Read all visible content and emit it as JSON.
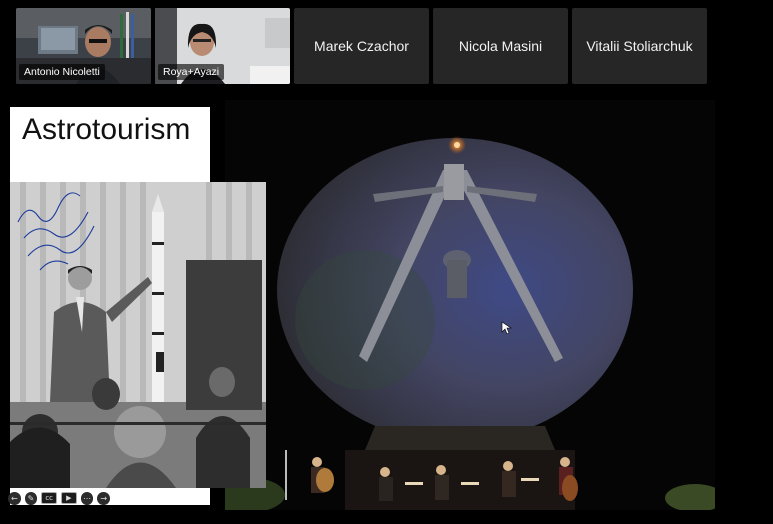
{
  "participants": [
    {
      "name": "Antonio Nicoletti",
      "has_video": true
    },
    {
      "name": "Roya+Ayazi",
      "has_video": true
    },
    {
      "name": "Marek Czachor",
      "has_video": false
    },
    {
      "name": "Nicola Masini",
      "has_video": false
    },
    {
      "name": "Vitalii Stoliarchuk",
      "has_video": false
    }
  ],
  "slide": {
    "title": "Astrotourism",
    "handwritten_note": "Rocco A. Petrone, Director of Launch Operations, Kennedy Space Center, NASA"
  },
  "toolbar": {
    "icons": [
      "arrow-left-icon",
      "pen-icon",
      "captions-icon",
      "video-icon",
      "more-icon",
      "arrow-right-icon"
    ]
  },
  "colors": {
    "background": "#000000",
    "tile_background": "#262626",
    "label_background": "#000000"
  }
}
